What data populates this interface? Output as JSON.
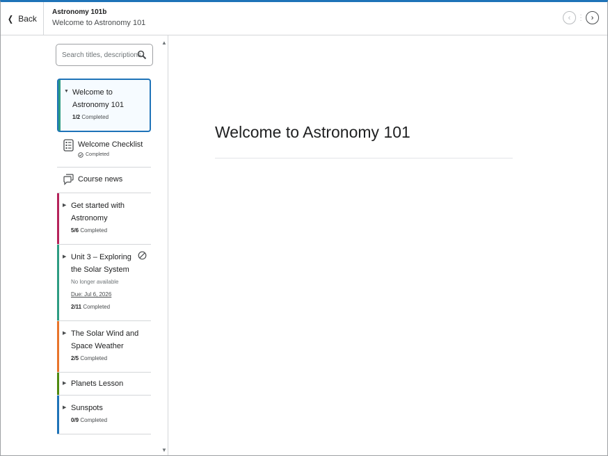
{
  "header": {
    "back_label": "Back",
    "course_title": "Astronomy 101b",
    "page_title": "Welcome to Astronomy 101",
    "prev_icon": "chevron-left-icon",
    "next_icon": "chevron-right-icon",
    "accent_color": "#1e73b8"
  },
  "search": {
    "placeholder": "Search titles, descriptions"
  },
  "toc": {
    "units": [
      {
        "title": "Welcome to Astronomy 101",
        "count": "1/2",
        "status": "Completed",
        "color": "#2d9c82",
        "expanded": true,
        "selected": true
      },
      {
        "title": "Get started with Astronomy",
        "count": "5/6",
        "status": "Completed",
        "color": "#b5235b"
      },
      {
        "title": "Unit 3 – Exploring the Solar System",
        "note": "No longer available",
        "due": "Due: Jul 6, 2026",
        "count": "2/11",
        "status": "Completed",
        "color": "#2d9c82"
      },
      {
        "title": "The Solar Wind and Space Weather",
        "count": "2/5",
        "status": "Completed",
        "color": "#e8742b"
      },
      {
        "title": "Planets Lesson",
        "color": "#4f8a10"
      },
      {
        "title": "Sunspots",
        "count": "0/9",
        "status": "Completed",
        "color": "#1e73b8"
      }
    ],
    "sub_items": [
      {
        "title": "Welcome Checklist",
        "status": "Completed",
        "icon": "checklist-icon"
      },
      {
        "title": "Course news",
        "icon": "discussion-icon"
      }
    ]
  },
  "content": {
    "heading": "Welcome to Astronomy 101"
  }
}
